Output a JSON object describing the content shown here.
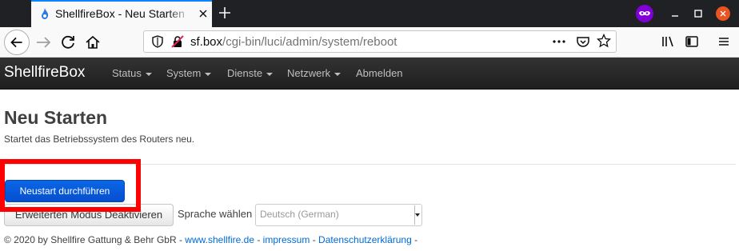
{
  "browser": {
    "tab_title": "ShellfireBox - Neu Starten",
    "url_host": "sf.box",
    "url_path": "/cgi-bin/luci/admin/system/reboot"
  },
  "router": {
    "brand": "ShellfireBox",
    "menu": [
      {
        "label": "Status",
        "has_dropdown": true
      },
      {
        "label": "System",
        "has_dropdown": true
      },
      {
        "label": "Dienste",
        "has_dropdown": true
      },
      {
        "label": "Netzwerk",
        "has_dropdown": true
      },
      {
        "label": "Abmelden",
        "has_dropdown": false
      }
    ]
  },
  "page": {
    "title": "Neu Starten",
    "description": "Startet das Betriebssystem des Routers neu.",
    "reboot_button": "Neustart durchführen",
    "expert_mode_button": "Erweiterten Modus Deaktivieren",
    "language_label": "Sprache wählen",
    "language_value": "Deutsch (German)"
  },
  "footer": {
    "copyright": "© 2020 by Shellfire Gattung & Behr GbR - ",
    "website_link": "www.shellfire.de",
    "sep1": " - ",
    "impressum_link": "impressum",
    "sep2": " - ",
    "privacy_link": "Datenschutzerklärung",
    "trail": " -"
  },
  "colors": {
    "accent": "#0a84ff",
    "primary_button": "#0a66e5",
    "highlight": "#ff0000",
    "topbar": "#222222",
    "private_browsing": "#8000d7",
    "window_close": "#e95420"
  }
}
